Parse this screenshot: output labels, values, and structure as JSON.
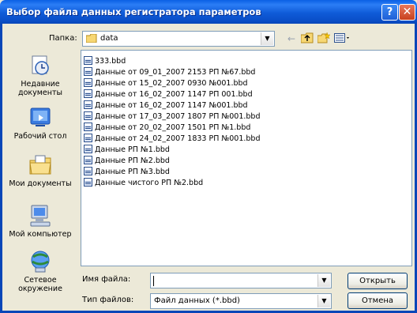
{
  "window": {
    "title": "Выбор файла данных регистратора параметров",
    "help_label": "?",
    "close_label": "✕"
  },
  "lookin": {
    "label": "Папка:",
    "value": "data"
  },
  "places": [
    {
      "label": "Недавние документы",
      "icon": "recent-documents-icon"
    },
    {
      "label": "Рабочий стол",
      "icon": "desktop-icon"
    },
    {
      "label": "Мои документы",
      "icon": "my-documents-icon"
    },
    {
      "label": "Мой компьютер",
      "icon": "my-computer-icon"
    },
    {
      "label": "Сетевое окружение",
      "icon": "network-places-icon"
    }
  ],
  "files": [
    "333.bbd",
    "Данные от 09_01_2007 2153  РП №67.bbd",
    "Данные от 15_02_2007 0930 №001.bbd",
    "Данные от 16_02_2007 1147  РП  001.bbd",
    "Данные от 16_02_2007 1147 №001.bbd",
    "Данные от 17_03_2007 1807  РП №001.bbd",
    "Данные от 20_02_2007 1501  РП №1.bbd",
    "Данные от 24_02_2007 1833  РП №001.bbd",
    "Данные РП №1.bbd",
    "Данные РП №2.bbd",
    "Данные РП №3.bbd",
    "Данные чистого РП №2.bbd"
  ],
  "filename": {
    "label": "Имя файла:",
    "value": ""
  },
  "filetype": {
    "label": "Тип файлов:",
    "value": "Файл данных (*.bbd)"
  },
  "buttons": {
    "open": "Открыть",
    "cancel": "Отмена"
  }
}
